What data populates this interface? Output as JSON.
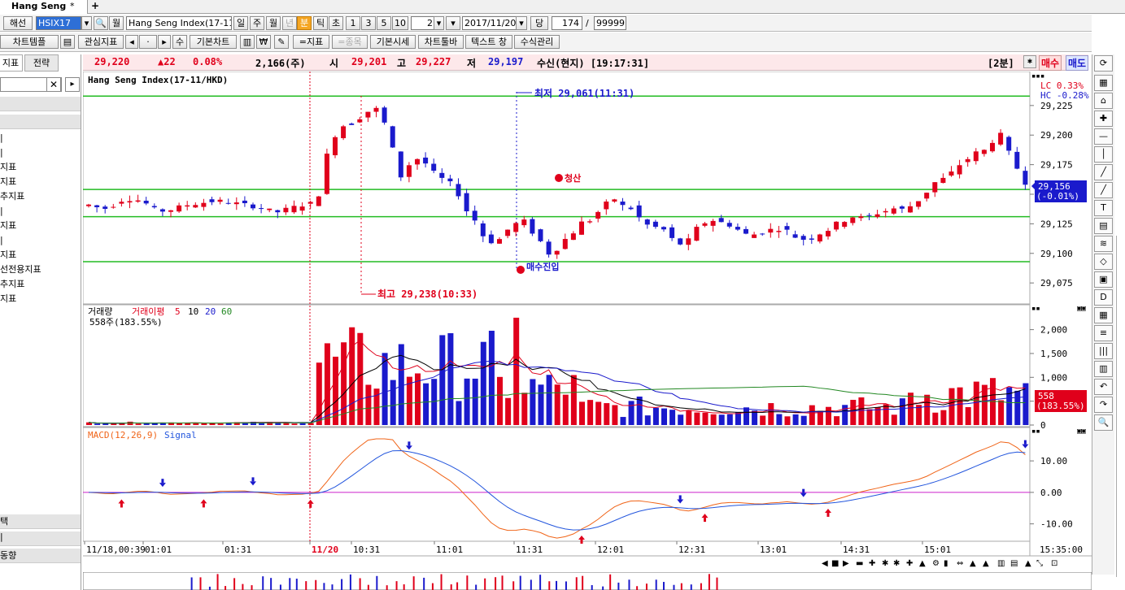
{
  "tab": {
    "title": "Hang Seng",
    "close": "*",
    "add": "+"
  },
  "toolbar1": {
    "market": "해선",
    "code": "HSIX17",
    "monthly": "월",
    "name": "Hang Seng Index(17-11",
    "periods": [
      "일",
      "주",
      "월",
      "년",
      "분",
      "틱",
      "초"
    ],
    "numbers": [
      "1",
      "3",
      "5",
      "10"
    ],
    "interval": "2",
    "date": "2017/11/20",
    "dang": "당",
    "count": "174",
    "slash": "/",
    "max": "99999"
  },
  "toolbar2": {
    "buttons": [
      "차트템플",
      "관심지표",
      "수",
      "기본차트",
      "=지표",
      "=종목",
      "기본시세",
      "차트툴바",
      "텍스트 창",
      "수식관리"
    ]
  },
  "quote": {
    "last": "29,220",
    "change": "▲22",
    "change_pct": "0.08%",
    "volume": "2,166(주)",
    "open_label": "시",
    "open": "29,201",
    "high_label": "고",
    "high": "29,227",
    "low_label": "저",
    "low": "29,197",
    "status": "수신(현지) [19:17:31]",
    "period": "[2분]",
    "buy": "매수",
    "sell": "매도"
  },
  "left_panel": {
    "tabs": [
      "지표",
      "전략"
    ],
    "items": [
      "|",
      "|",
      "지표",
      "지표",
      "추지표",
      "|",
      "지표",
      "|",
      "지표",
      "선전용지표",
      "추지표",
      "지표"
    ],
    "bottom_items": [
      "택",
      "|",
      "동향"
    ]
  },
  "price_pane": {
    "title": "Hang Seng Index(17-11/HKD)",
    "lc": "LC  0.33%",
    "hc": "HC -0.28%",
    "y_ticks": [
      "29,225",
      "29,200",
      "29,175",
      "29,150",
      "29,125",
      "29,100",
      "29,075"
    ],
    "current_price": "29,156",
    "current_change": "(-0.01%)",
    "low_annotation": "최저 29,061(11:31)",
    "high_annotation": "최고 29,238(10:33)",
    "exit_label": "청산",
    "entry_label": "매수진입"
  },
  "volume_pane": {
    "title": "거래량",
    "ma_title": "거래이평",
    "ma_periods": [
      "5",
      "10",
      "20",
      "60"
    ],
    "info": "558주(183.55%)",
    "y_ticks": [
      "2,000",
      "1,500",
      "1,000",
      "500",
      "0"
    ],
    "current": "558",
    "current_pct": "(183.55%)"
  },
  "macd_pane": {
    "title": "MACD(12,26,9)",
    "signal": "Signal",
    "y_ticks": [
      "10.00",
      "0.00",
      "-10.00"
    ]
  },
  "x_axis": {
    "ticks": [
      "11/18,00:39",
      "01:01",
      "01:31",
      "11/20",
      "10:31",
      "11:01",
      "11:31",
      "12:01",
      "12:31",
      "13:01",
      "14:31",
      "15:01"
    ],
    "end_time": "15:35:00"
  },
  "colors": {
    "up": "#e0001b",
    "down": "#1a1acc",
    "support": "#22bb22",
    "macd": "#f06418",
    "signal": "#2255dd",
    "zero": "#cc22cc"
  },
  "chart_data": {
    "type": "candlestick",
    "price_support_levels": [
      29233,
      29154,
      29131,
      29093
    ],
    "price_ylim": [
      29060,
      29240
    ],
    "volume_ylim": [
      0,
      2300
    ],
    "macd_ylim": [
      -15,
      17
    ]
  }
}
